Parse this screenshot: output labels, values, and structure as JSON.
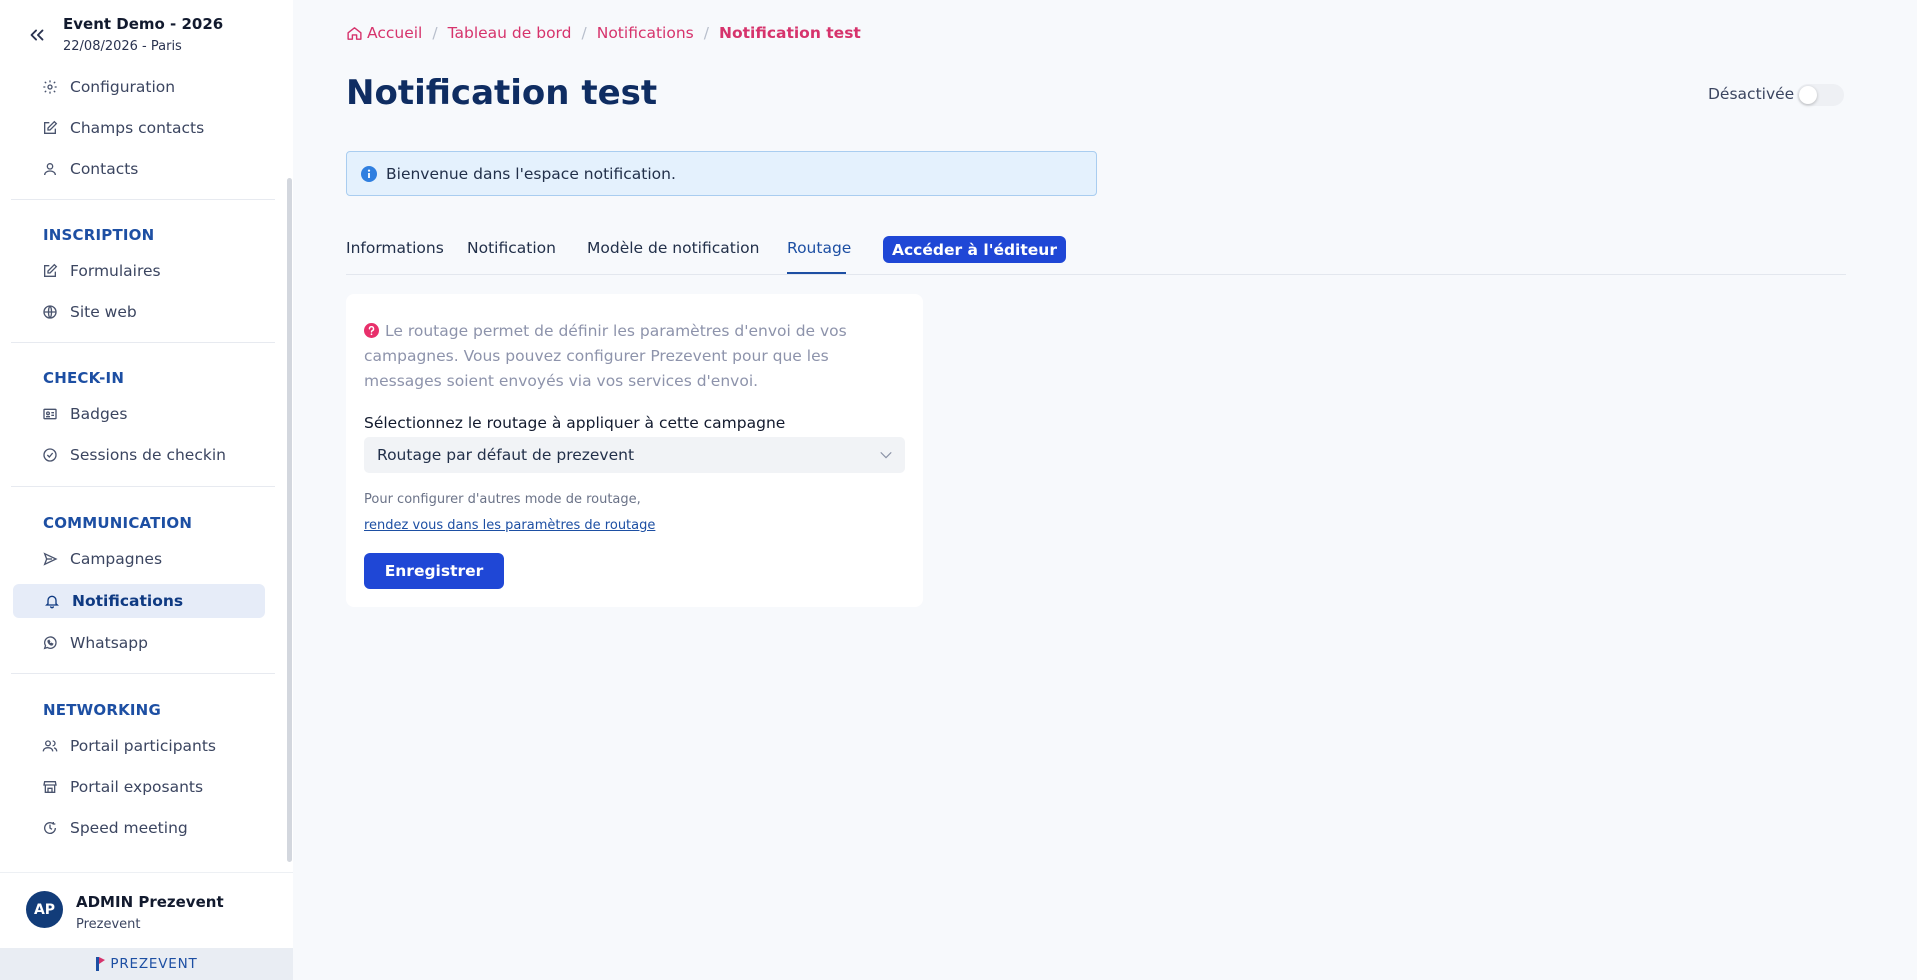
{
  "event": {
    "title": "Event Demo - 2026",
    "subtitle": "22/08/2026 - Paris"
  },
  "sidebar": {
    "top_items": [
      {
        "label": "Configuration",
        "icon": "gear-icon"
      },
      {
        "label": "Champs contacts",
        "icon": "edit-icon"
      },
      {
        "label": "Contacts",
        "icon": "user-icon"
      }
    ],
    "sections": [
      {
        "label": "INSCRIPTION",
        "items": [
          {
            "label": "Formulaires",
            "icon": "edit-icon"
          },
          {
            "label": "Site web",
            "icon": "globe-icon"
          }
        ]
      },
      {
        "label": "CHECK-IN",
        "items": [
          {
            "label": "Badges",
            "icon": "badge-icon"
          },
          {
            "label": "Sessions de checkin",
            "icon": "check-circle-icon"
          }
        ]
      },
      {
        "label": "COMMUNICATION",
        "items": [
          {
            "label": "Campagnes",
            "icon": "send-icon"
          },
          {
            "label": "Notifications",
            "icon": "bell-icon",
            "active": true
          },
          {
            "label": "Whatsapp",
            "icon": "whatsapp-icon"
          }
        ]
      },
      {
        "label": "NETWORKING",
        "items": [
          {
            "label": "Portail participants",
            "icon": "users-icon"
          },
          {
            "label": "Portail exposants",
            "icon": "store-icon"
          },
          {
            "label": "Speed meeting",
            "icon": "clock-icon"
          }
        ]
      }
    ]
  },
  "user": {
    "initials": "AP",
    "name": "ADMIN Prezevent",
    "org": "Prezevent"
  },
  "brand": {
    "name": "PREZEVENT"
  },
  "breadcrumb": [
    "Accueil",
    "Tableau de bord",
    "Notifications",
    "Notification test"
  ],
  "page": {
    "title": "Notification test",
    "status_label": "Désactivée",
    "enabled": false
  },
  "banner": {
    "text": "Bienvenue dans l'espace notification."
  },
  "tabs": {
    "items": [
      "Informations",
      "Notification",
      "Modèle de notification",
      "Routage"
    ],
    "active": "Routage",
    "editor_button": "Accéder à l'éditeur"
  },
  "routing": {
    "help": "Le routage permet de définir les paramètres d'envoi de vos campagnes. Vous pouvez configurer Prezevent pour que les messages soient envoyés via vos services d'envoi.",
    "select_label": "Sélectionnez le routage à appliquer à cette campagne",
    "selected": "Routage par défaut de prezevent",
    "hint": "Pour configurer d'autres mode de routage,",
    "hint_link": "rendez vous dans les paramètres de routage",
    "save_label": "Enregistrer"
  },
  "colors": {
    "accent": "#1f47d6",
    "breadcrumb": "#d6336c",
    "title": "#0f2d62",
    "section": "#1d4fa3"
  }
}
